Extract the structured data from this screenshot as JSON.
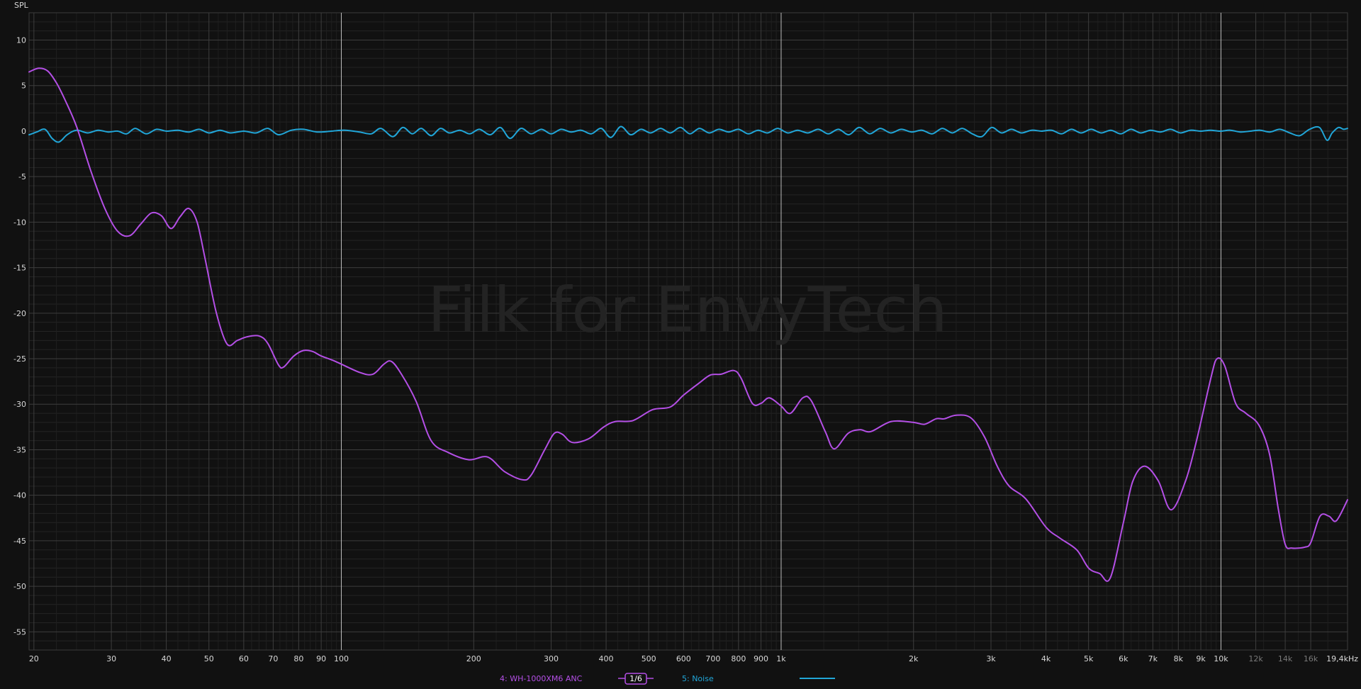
{
  "chart_data": {
    "type": "line",
    "title": "",
    "ylabel": "SPL",
    "xlabel": "",
    "xscale": "log",
    "xlim": [
      19.5,
      19400
    ],
    "ylim": [
      -57,
      13
    ],
    "grid": true,
    "watermark": "Filk for EnvyTech",
    "yticks": [
      10,
      5,
      0,
      -5,
      -10,
      -15,
      -20,
      -25,
      -30,
      -35,
      -40,
      -45,
      -50,
      -55
    ],
    "ytick_labels": [
      "10",
      "5",
      "0",
      "-5",
      "-10",
      "-15",
      "-20",
      "-25",
      "-30",
      "-35",
      "-40",
      "-45",
      "-50",
      "-55"
    ],
    "xticks": [
      {
        "value": 20,
        "label": "20"
      },
      {
        "value": 30,
        "label": "30"
      },
      {
        "value": 40,
        "label": "40"
      },
      {
        "value": 50,
        "label": "50"
      },
      {
        "value": 60,
        "label": "60"
      },
      {
        "value": 70,
        "label": "70"
      },
      {
        "value": 80,
        "label": "80"
      },
      {
        "value": 90,
        "label": "90"
      },
      {
        "value": 100,
        "label": "100"
      },
      {
        "value": 200,
        "label": "200"
      },
      {
        "value": 300,
        "label": "300"
      },
      {
        "value": 400,
        "label": "400"
      },
      {
        "value": 500,
        "label": "500"
      },
      {
        "value": 600,
        "label": "600"
      },
      {
        "value": 700,
        "label": "700"
      },
      {
        "value": 800,
        "label": "800"
      },
      {
        "value": 900,
        "label": "900"
      },
      {
        "value": 1000,
        "label": "1k"
      },
      {
        "value": 2000,
        "label": "2k"
      },
      {
        "value": 3000,
        "label": "3k"
      },
      {
        "value": 4000,
        "label": "4k"
      },
      {
        "value": 5000,
        "label": "5k"
      },
      {
        "value": 6000,
        "label": "6k"
      },
      {
        "value": 7000,
        "label": "7k"
      },
      {
        "value": 8000,
        "label": "8k"
      },
      {
        "value": 9000,
        "label": "9k"
      },
      {
        "value": 10000,
        "label": "10k"
      },
      {
        "value": 12000,
        "label": "12k"
      },
      {
        "value": 14000,
        "label": "14k"
      },
      {
        "value": 16000,
        "label": "16k"
      },
      {
        "value": 19400,
        "label": "19,4kHz"
      }
    ],
    "legend_placement": "bottom-center",
    "series": [
      {
        "name": "4: WH-1000XM6 ANC",
        "color": "#b44fe6",
        "smoothing_label": "1/6",
        "points": [
          [
            19.5,
            6.5
          ],
          [
            20.5,
            6.9
          ],
          [
            21.5,
            6.6
          ],
          [
            22.5,
            5.3
          ],
          [
            23.5,
            3.5
          ],
          [
            25,
            0.5
          ],
          [
            27,
            -4.5
          ],
          [
            29,
            -8.5
          ],
          [
            31,
            -11.0
          ],
          [
            33,
            -11.5
          ],
          [
            35,
            -10.2
          ],
          [
            37,
            -9.0
          ],
          [
            39,
            -9.3
          ],
          [
            41,
            -10.7
          ],
          [
            43,
            -9.4
          ],
          [
            45,
            -8.5
          ],
          [
            47,
            -10.0
          ],
          [
            49,
            -14.0
          ],
          [
            52,
            -20.0
          ],
          [
            55,
            -23.4
          ],
          [
            58,
            -23.0
          ],
          [
            61,
            -22.6
          ],
          [
            65,
            -22.5
          ],
          [
            68,
            -23.3
          ],
          [
            72,
            -25.7
          ],
          [
            74,
            -25.9
          ],
          [
            78,
            -24.7
          ],
          [
            82,
            -24.1
          ],
          [
            86,
            -24.2
          ],
          [
            90,
            -24.7
          ],
          [
            97,
            -25.3
          ],
          [
            110,
            -26.5
          ],
          [
            118,
            -26.7
          ],
          [
            125,
            -25.6
          ],
          [
            130,
            -25.3
          ],
          [
            137,
            -26.7
          ],
          [
            148,
            -29.7
          ],
          [
            160,
            -34.0
          ],
          [
            175,
            -35.3
          ],
          [
            195,
            -36.1
          ],
          [
            215,
            -35.8
          ],
          [
            235,
            -37.4
          ],
          [
            258,
            -38.3
          ],
          [
            270,
            -37.8
          ],
          [
            290,
            -35.0
          ],
          [
            305,
            -33.2
          ],
          [
            318,
            -33.3
          ],
          [
            335,
            -34.2
          ],
          [
            365,
            -33.8
          ],
          [
            395,
            -32.5
          ],
          [
            420,
            -31.9
          ],
          [
            460,
            -31.8
          ],
          [
            510,
            -30.6
          ],
          [
            560,
            -30.3
          ],
          [
            600,
            -29.0
          ],
          [
            650,
            -27.7
          ],
          [
            690,
            -26.8
          ],
          [
            730,
            -26.7
          ],
          [
            780,
            -26.3
          ],
          [
            810,
            -27.1
          ],
          [
            860,
            -29.9
          ],
          [
            900,
            -29.9
          ],
          [
            940,
            -29.3
          ],
          [
            1000,
            -30.2
          ],
          [
            1050,
            -31.0
          ],
          [
            1120,
            -29.3
          ],
          [
            1170,
            -29.6
          ],
          [
            1260,
            -33.0
          ],
          [
            1320,
            -34.9
          ],
          [
            1420,
            -33.2
          ],
          [
            1510,
            -32.8
          ],
          [
            1600,
            -33.0
          ],
          [
            1780,
            -31.9
          ],
          [
            2000,
            -32.0
          ],
          [
            2120,
            -32.2
          ],
          [
            2250,
            -31.6
          ],
          [
            2350,
            -31.6
          ],
          [
            2500,
            -31.2
          ],
          [
            2700,
            -31.5
          ],
          [
            2900,
            -33.6
          ],
          [
            3100,
            -36.8
          ],
          [
            3300,
            -39.0
          ],
          [
            3600,
            -40.4
          ],
          [
            4000,
            -43.5
          ],
          [
            4300,
            -44.7
          ],
          [
            4700,
            -46.0
          ],
          [
            5000,
            -48.0
          ],
          [
            5300,
            -48.6
          ],
          [
            5600,
            -49.1
          ],
          [
            6000,
            -43.0
          ],
          [
            6300,
            -38.5
          ],
          [
            6700,
            -36.8
          ],
          [
            7200,
            -38.4
          ],
          [
            7700,
            -41.6
          ],
          [
            8300,
            -38.5
          ],
          [
            8800,
            -34.0
          ],
          [
            9500,
            -27.0
          ],
          [
            9800,
            -25.0
          ],
          [
            10200,
            -25.8
          ],
          [
            10800,
            -29.9
          ],
          [
            11400,
            -31.0
          ],
          [
            12200,
            -32.3
          ],
          [
            12900,
            -35.5
          ],
          [
            13500,
            -41.5
          ],
          [
            14000,
            -45.4
          ],
          [
            14500,
            -45.8
          ],
          [
            15500,
            -45.7
          ],
          [
            16000,
            -45.2
          ],
          [
            16800,
            -42.3
          ],
          [
            17600,
            -42.3
          ],
          [
            18300,
            -42.8
          ],
          [
            19400,
            -40.5
          ]
        ]
      },
      {
        "name": "5: Noise",
        "color": "#21a6d8",
        "points": [
          [
            19.5,
            -0.4
          ],
          [
            20.3,
            -0.1
          ],
          [
            21.2,
            0.2
          ],
          [
            22,
            -0.8
          ],
          [
            22.8,
            -1.2
          ],
          [
            23.8,
            -0.4
          ],
          [
            25,
            0.1
          ],
          [
            26.5,
            -0.2
          ],
          [
            28,
            0.1
          ],
          [
            29.5,
            -0.1
          ],
          [
            31,
            0.0
          ],
          [
            32.5,
            -0.3
          ],
          [
            34,
            0.3
          ],
          [
            36,
            -0.3
          ],
          [
            38,
            0.2
          ],
          [
            40,
            0.0
          ],
          [
            42.5,
            0.1
          ],
          [
            45,
            -0.1
          ],
          [
            47.5,
            0.2
          ],
          [
            50,
            -0.2
          ],
          [
            53,
            0.1
          ],
          [
            56,
            -0.2
          ],
          [
            60,
            0.0
          ],
          [
            64,
            -0.2
          ],
          [
            68,
            0.3
          ],
          [
            72,
            -0.4
          ],
          [
            77,
            0.1
          ],
          [
            82,
            0.2
          ],
          [
            88,
            -0.1
          ],
          [
            95,
            0.0
          ],
          [
            102,
            0.1
          ],
          [
            110,
            -0.1
          ],
          [
            117,
            -0.3
          ],
          [
            123,
            0.3
          ],
          [
            131,
            -0.6
          ],
          [
            138,
            0.4
          ],
          [
            145,
            -0.3
          ],
          [
            152,
            0.3
          ],
          [
            160,
            -0.5
          ],
          [
            168,
            0.3
          ],
          [
            176,
            -0.2
          ],
          [
            186,
            0.1
          ],
          [
            196,
            -0.3
          ],
          [
            206,
            0.2
          ],
          [
            218,
            -0.4
          ],
          [
            230,
            0.4
          ],
          [
            242,
            -0.8
          ],
          [
            256,
            0.3
          ],
          [
            270,
            -0.3
          ],
          [
            285,
            0.2
          ],
          [
            300,
            -0.3
          ],
          [
            316,
            0.2
          ],
          [
            333,
            -0.1
          ],
          [
            351,
            0.1
          ],
          [
            370,
            -0.3
          ],
          [
            390,
            0.3
          ],
          [
            410,
            -0.7
          ],
          [
            432,
            0.5
          ],
          [
            455,
            -0.4
          ],
          [
            480,
            0.2
          ],
          [
            505,
            -0.2
          ],
          [
            532,
            0.3
          ],
          [
            560,
            -0.2
          ],
          [
            590,
            0.4
          ],
          [
            620,
            -0.3
          ],
          [
            652,
            0.3
          ],
          [
            686,
            -0.2
          ],
          [
            722,
            0.2
          ],
          [
            760,
            -0.1
          ],
          [
            800,
            0.2
          ],
          [
            842,
            -0.3
          ],
          [
            886,
            0.1
          ],
          [
            932,
            -0.2
          ],
          [
            982,
            0.3
          ],
          [
            1035,
            -0.2
          ],
          [
            1090,
            0.1
          ],
          [
            1150,
            -0.2
          ],
          [
            1215,
            0.2
          ],
          [
            1280,
            -0.3
          ],
          [
            1350,
            0.2
          ],
          [
            1425,
            -0.4
          ],
          [
            1505,
            0.4
          ],
          [
            1590,
            -0.3
          ],
          [
            1680,
            0.3
          ],
          [
            1775,
            -0.2
          ],
          [
            1875,
            0.2
          ],
          [
            1980,
            -0.1
          ],
          [
            2090,
            0.1
          ],
          [
            2205,
            -0.3
          ],
          [
            2325,
            0.3
          ],
          [
            2450,
            -0.2
          ],
          [
            2580,
            0.3
          ],
          [
            2720,
            -0.3
          ],
          [
            2860,
            -0.6
          ],
          [
            3010,
            0.4
          ],
          [
            3170,
            -0.2
          ],
          [
            3340,
            0.2
          ],
          [
            3520,
            -0.2
          ],
          [
            3710,
            0.1
          ],
          [
            3910,
            0.0
          ],
          [
            4120,
            0.1
          ],
          [
            4340,
            -0.3
          ],
          [
            4570,
            0.2
          ],
          [
            4810,
            -0.2
          ],
          [
            5070,
            0.2
          ],
          [
            5340,
            -0.2
          ],
          [
            5620,
            0.1
          ],
          [
            5920,
            -0.3
          ],
          [
            6240,
            0.2
          ],
          [
            6570,
            -0.2
          ],
          [
            6920,
            0.1
          ],
          [
            7290,
            -0.1
          ],
          [
            7680,
            0.2
          ],
          [
            8090,
            -0.2
          ],
          [
            8520,
            0.1
          ],
          [
            8980,
            0.0
          ],
          [
            9460,
            0.1
          ],
          [
            9960,
            0.0
          ],
          [
            10500,
            0.1
          ],
          [
            11060,
            -0.1
          ],
          [
            11650,
            0.0
          ],
          [
            12270,
            0.1
          ],
          [
            12920,
            -0.1
          ],
          [
            13610,
            0.2
          ],
          [
            14340,
            -0.2
          ],
          [
            15100,
            -0.5
          ],
          [
            15900,
            0.2
          ],
          [
            16750,
            0.4
          ],
          [
            17420,
            -1.0
          ],
          [
            17900,
            -0.2
          ],
          [
            18500,
            0.4
          ],
          [
            19000,
            0.2
          ],
          [
            19400,
            0.3
          ]
        ]
      }
    ]
  }
}
